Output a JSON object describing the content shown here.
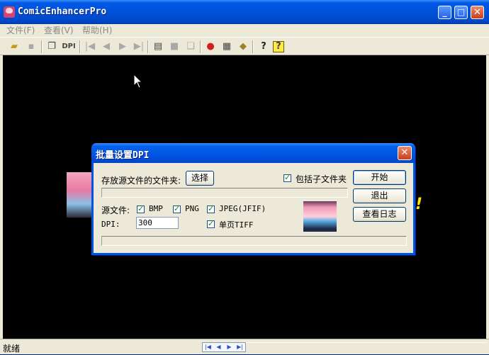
{
  "window": {
    "title": "ComicEnhancerPro"
  },
  "menu": [
    "文件(F)",
    "查看(V)",
    "帮助(H)"
  ],
  "toolbar": {
    "dpi_label": "DPI"
  },
  "status": {
    "text": "就绪"
  },
  "dialog": {
    "title": "批量设置DPI",
    "folder_label": "存放源文件的文件夹:",
    "choose_button": "选择",
    "include_subfolders": {
      "label": "包括子文件夹",
      "checked": true
    },
    "start_button": "开始",
    "exit_button": "退出",
    "log_button": "查看日志",
    "source_label": "源文件:",
    "formats": [
      {
        "label": "BMP",
        "checked": true
      },
      {
        "label": "PNG",
        "checked": true
      },
      {
        "label": "JPEG(JFIF)",
        "checked": true
      }
    ],
    "single_tiff": {
      "label": "单页TIFF",
      "checked": true
    },
    "dpi_label": "DPI:",
    "dpi_value": "300"
  },
  "colors": {
    "titlebar": "#0054e3",
    "workarea": "#000000",
    "face": "#ece9d8"
  }
}
